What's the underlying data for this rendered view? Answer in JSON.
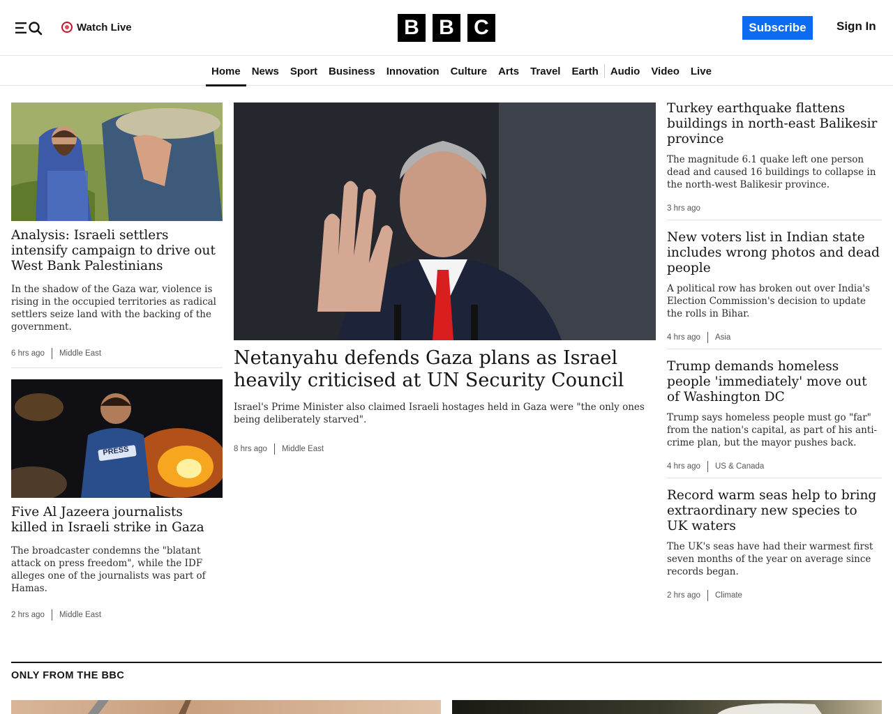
{
  "header": {
    "watch_live_label": "Watch Live",
    "logo_letters": [
      "B",
      "B",
      "C"
    ],
    "subscribe_label": "Subscribe",
    "sign_in_label": "Sign In"
  },
  "nav": {
    "items": [
      {
        "label": "Home",
        "active": true
      },
      {
        "label": "News"
      },
      {
        "label": "Sport"
      },
      {
        "label": "Business"
      },
      {
        "label": "Innovation"
      },
      {
        "label": "Culture"
      },
      {
        "label": "Arts"
      },
      {
        "label": "Travel"
      },
      {
        "label": "Earth"
      },
      {
        "label": "Audio"
      },
      {
        "label": "Video"
      },
      {
        "label": "Live"
      }
    ]
  },
  "left_stories": [
    {
      "headline": "Analysis: Israeli settlers intensify campaign to drive out West Bank Palestinians",
      "summary": "In the shadow of the Gaza war, violence is rising in the occupied territories as radical settlers seize land with the backing of the government.",
      "time": "6 hrs ago",
      "section": "Middle East"
    },
    {
      "headline": "Five Al Jazeera journalists killed in Israeli strike in Gaza",
      "summary": "The broadcaster condemns the \"blatant attack on press freedom\", while the IDF alleges one of the journalists was part of Hamas.",
      "time": "2 hrs ago",
      "section": "Middle East",
      "image_text": "PRESS"
    }
  ],
  "main_story": {
    "headline": "Netanyahu defends Gaza plans as Israel heavily criticised at UN Security Council",
    "summary": "Israel's Prime Minister also claimed Israeli hostages held in Gaza were \"the only ones being deliberately starved\".",
    "time": "8 hrs ago",
    "section": "Middle East"
  },
  "right_stories": [
    {
      "headline": "Turkey earthquake flattens buildings in north-east Balikesir province",
      "summary": "The magnitude 6.1 quake left one person dead and caused 16 buildings to collapse in the north-west Balikesir province.",
      "time": "3 hrs ago",
      "section": ""
    },
    {
      "headline": "New voters list in Indian state includes wrong photos and dead people",
      "summary": "A political row has broken out over India's Election Commission's decision to update the rolls in Bihar.",
      "time": "4 hrs ago",
      "section": "Asia"
    },
    {
      "headline": "Trump demands homeless people 'immediately' move out of Washington DC",
      "summary": "Trump says homeless people must go \"far\" from the nation's capital, as part of his anti-crime plan, but the mayor pushes back.",
      "time": "4 hrs ago",
      "section": "US & Canada"
    },
    {
      "headline": "Record warm seas help to bring extraordinary new species to UK waters",
      "summary": "The UK's seas have had their warmest first seven months of the year on average since records began.",
      "time": "2 hrs ago",
      "section": "Climate"
    }
  ],
  "only_from_bbc": {
    "title": "ONLY FROM THE BBC"
  },
  "colors": {
    "subscribe_blue": "#0b6cf2",
    "live_red": "#c8102e",
    "text": "#141414"
  }
}
